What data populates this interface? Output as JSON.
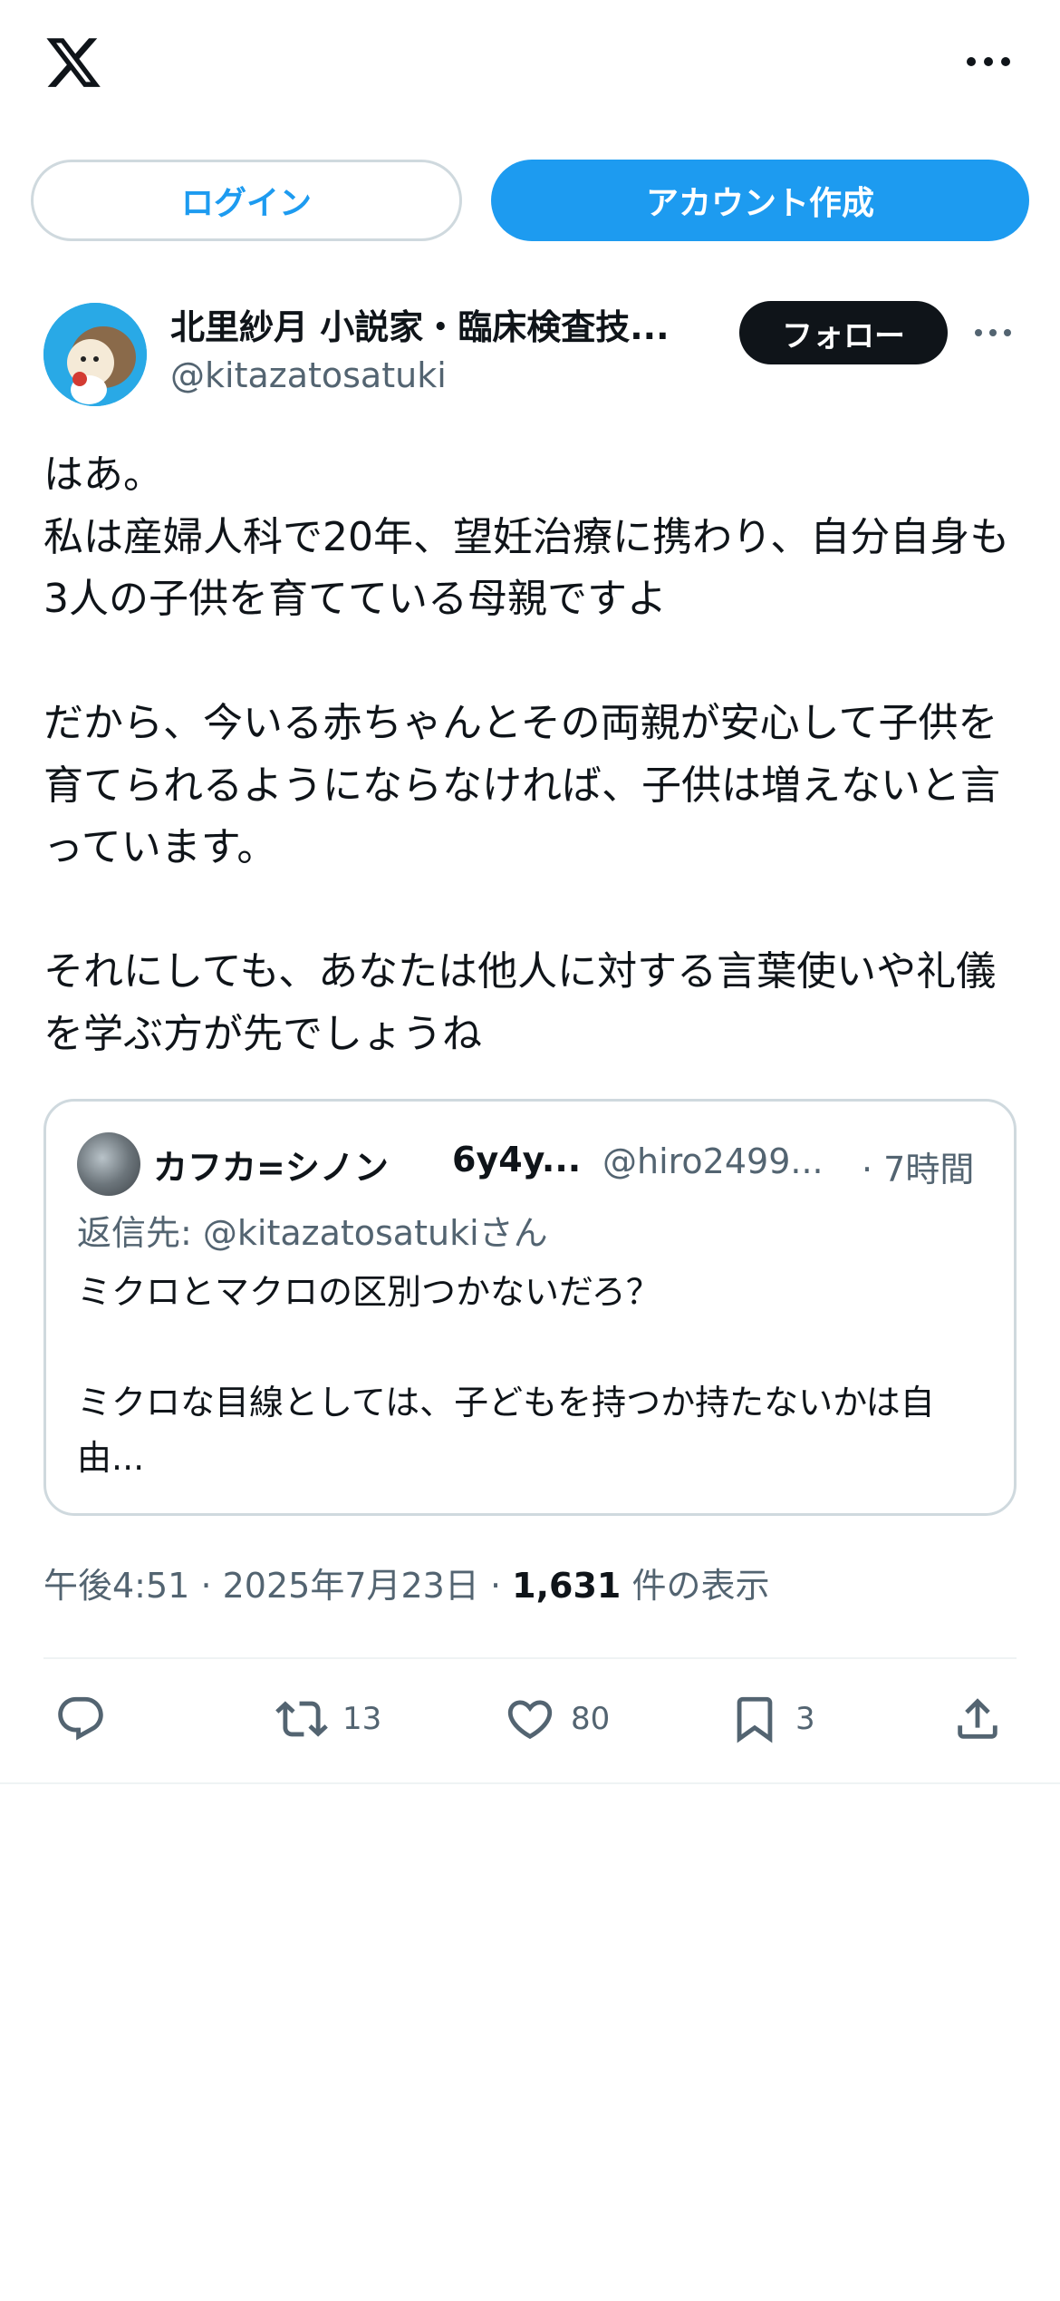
{
  "header": {
    "logo_icon": "x-logo-icon",
    "more_icon": "more-horizontal-icon"
  },
  "auth": {
    "login_label": "ログイン",
    "signup_label": "アカウント作成"
  },
  "tweet": {
    "display_name": "北里紗月 小説家・臨床検査技...",
    "handle": "@kitazatosatuki",
    "follow_label": "フォロー",
    "text": "はあ。\n私は産婦人科で20年、望妊治療に携わり、自分自身も3人の子供を育てている母親ですよ\n\nだから、今いる赤ちゃんとその両親が安心して子供を育てられるようにならなければ、子供は増えないと言っています。\n\nそれにしても、あなたは他人に対する言葉使いや礼儀を学ぶ方が先でしょうね",
    "time": "午後4:51",
    "date": "2025年7月23日",
    "views_count": "1,631",
    "views_label": "件の表示",
    "separator": "·"
  },
  "quote": {
    "name": "カフカ=シノン",
    "name2": "6y4y...",
    "handle": "@hiro2499...",
    "time": "· 7時間",
    "reply_to": "返信先: @kitazatosatukiさん",
    "text": "ミクロとマクロの区別つかないだろ？\n\nミクロな目線としては、子どもを持つか持たないかは自由..."
  },
  "actions": {
    "reply_icon": "reply-icon",
    "retweet_icon": "retweet-icon",
    "retweet_count": "13",
    "like_icon": "heart-icon",
    "like_count": "80",
    "bookmark_icon": "bookmark-icon",
    "bookmark_count": "3",
    "share_icon": "share-icon"
  },
  "colors": {
    "accent": "#1d9bf0",
    "text_primary": "#0f1419",
    "text_secondary": "#536471",
    "border": "#cfd9de"
  }
}
